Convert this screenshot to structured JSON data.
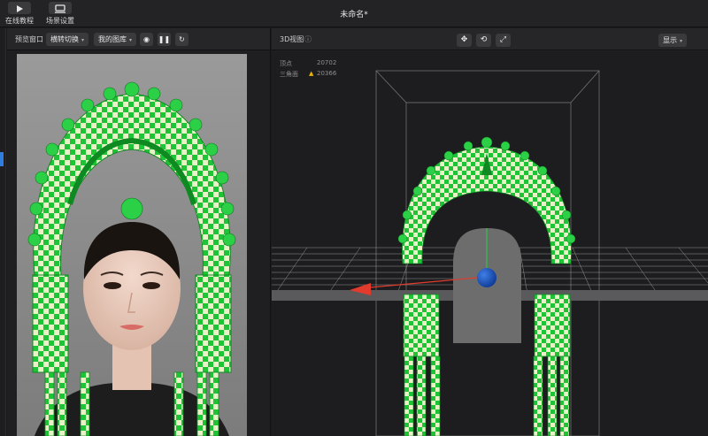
{
  "app": {
    "title": "未命名*"
  },
  "toolbar": {
    "tutorial_label": "在线教程",
    "scene_label": "场景设置"
  },
  "left_panel": {
    "title": "预览窗口",
    "mode_dropdown": "横转切换",
    "library_dropdown": "我的图库",
    "buttons": [
      "record",
      "pause",
      "refresh"
    ]
  },
  "right_panel": {
    "title": "3D视图",
    "display_dropdown": "显示",
    "stats": {
      "vertices_label": "顶点",
      "vertices_value": "20702",
      "triangles_label": "三角面",
      "triangles_value": "20366"
    }
  },
  "colors": {
    "accent": "#2f7de1",
    "ornament_green": "#22c43a",
    "ornament_cream": "#e8f2c6",
    "background": "#1b1b1d"
  }
}
